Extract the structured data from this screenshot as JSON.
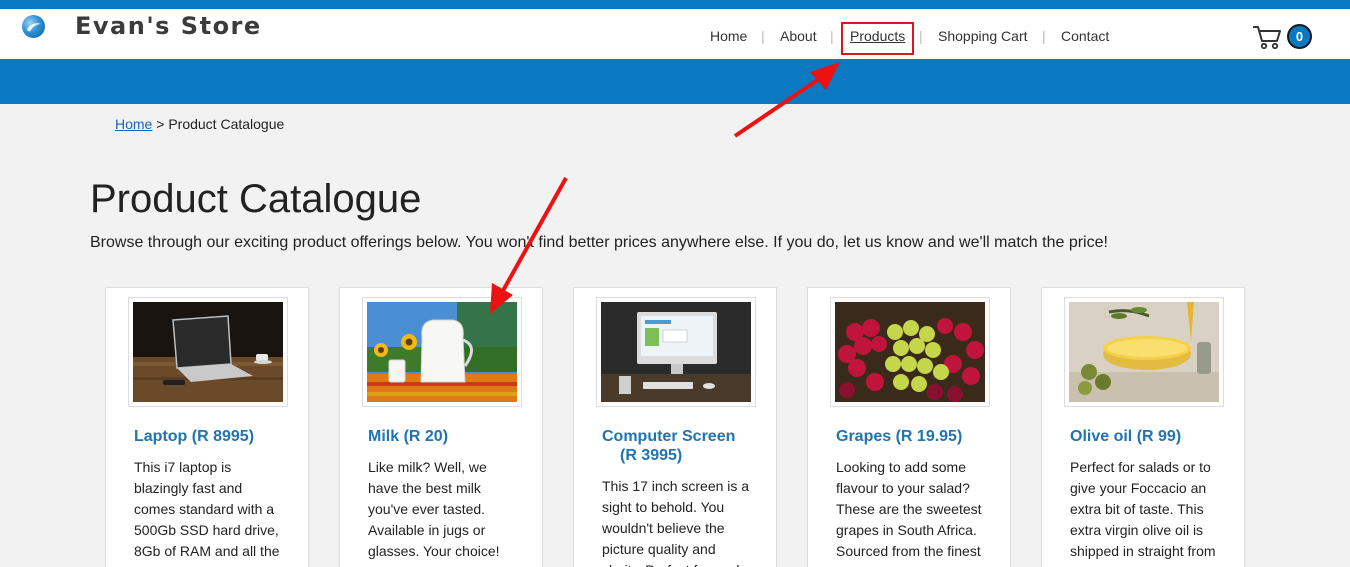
{
  "brand": {
    "name": "Evan's Store"
  },
  "nav": {
    "items": [
      {
        "label": "Home"
      },
      {
        "label": "About"
      },
      {
        "label": "Products",
        "active": true
      },
      {
        "label": "Shopping Cart"
      },
      {
        "label": "Contact"
      }
    ],
    "separator": "|"
  },
  "cart": {
    "count": "0"
  },
  "breadcrumb": {
    "home": "Home",
    "sep": " > ",
    "current": "Product Catalogue"
  },
  "page": {
    "title": "Product Catalogue",
    "intro": "Browse through our exciting product offerings below. You won't find better prices anywhere else. If you do, let us know and we'll match the price!"
  },
  "products": [
    {
      "title": "Laptop (R 8995)",
      "desc": "This i7 laptop is blazingly fast and comes standard with a 500Gb SSD hard drive, 8Gb of RAM and all the",
      "image": "laptop-image"
    },
    {
      "title": "Milk (R 20)",
      "desc": "Like milk? Well, we have the best milk you've ever tasted. Available in jugs or glasses. Your choice!",
      "image": "milk-image"
    },
    {
      "title_line1": "Computer Screen",
      "title_line2": "(R 3995)",
      "desc": "This 17 inch screen is a sight to behold. You wouldn't believe the picture quality and clarity. Perfect for work",
      "image": "computer-screen-image"
    },
    {
      "title": "Grapes (R 19.95)",
      "desc": "Looking to add some flavour to your salad? These are the sweetest grapes in South Africa. Sourced from the finest",
      "image": "grapes-image"
    },
    {
      "title": "Olive oil (R 99)",
      "desc": "Perfect for salads or to give your Foccacio an extra bit of taste. This extra virgin olive oil is shipped in straight from",
      "image": "olive-oil-image"
    }
  ],
  "colors": {
    "brand_blue": "#0b78c2",
    "link_blue": "#1f74b3",
    "highlight_red": "#e0141e"
  },
  "icons": [
    "logo-icon",
    "shopping-cart-icon",
    "annotation-arrow-icon"
  ]
}
